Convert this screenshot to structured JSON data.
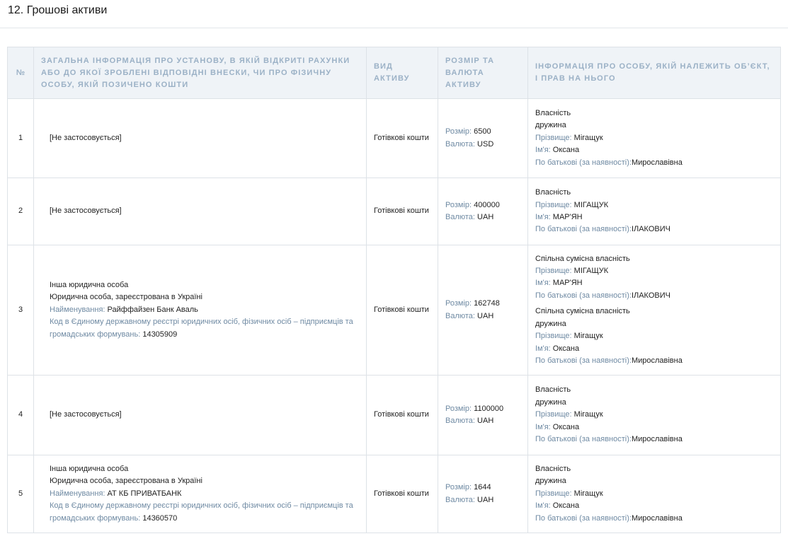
{
  "section_title": "12. Грошові активи",
  "columns": {
    "num": "№",
    "info": "Загальна інформація про установу, в якій відкриті рахунки або до якої зроблені відповідні внески, чи про фізичну особу, якій позичено кошти",
    "type": "Вид активу",
    "size": "Розмір та валюта активу",
    "owner": "Інформація про особу, якій належить об’єкт, і прав на нього"
  },
  "labels": {
    "size": "Розмір:",
    "currency": "Валюта:",
    "surname": "Прізвище:",
    "name": "Ім'я:",
    "patronymic": "По батькові (за наявності):",
    "org_name": "Найменування:",
    "org_code": "Код в Єдиному державному реєстрі юридичних осіб, фізичних осіб – підприємців та громадських формувань:"
  },
  "rows": [
    {
      "num": "1",
      "info_text": "[Не застосовується]",
      "asset_type": "Готівкові кошти",
      "size": "6500",
      "currency": "USD",
      "owners": [
        {
          "right": "Власність",
          "relation": "дружина",
          "surname": "Мігащук",
          "name": "Оксана",
          "patronymic": "Мирославівна"
        }
      ]
    },
    {
      "num": "2",
      "info_text": "[Не застосовується]",
      "asset_type": "Готівкові кошти",
      "size": "400000",
      "currency": "UAH",
      "owners": [
        {
          "right": "Власність",
          "surname": "МІГАЩУК",
          "name": "МАР'ЯН",
          "patronymic": "ІЛАКОВИЧ"
        }
      ]
    },
    {
      "num": "3",
      "org_kind": "Інша юридична особа",
      "org_reg": "Юридична особа, зареєстрована в Україні",
      "org_name": "Райффайзен Банк Аваль",
      "org_code": "14305909",
      "asset_type": "Готівкові кошти",
      "size": "162748",
      "currency": "UAH",
      "owners": [
        {
          "right": "Спільна сумісна власність",
          "surname": "МІГАЩУК",
          "name": "МАР'ЯН",
          "patronymic": "ІЛАКОВИЧ"
        },
        {
          "right": "Спільна сумісна власність",
          "relation": "дружина",
          "surname": "Мігащук",
          "name": "Оксана",
          "patronymic": "Мирославівна"
        }
      ]
    },
    {
      "num": "4",
      "info_text": "[Не застосовується]",
      "asset_type": "Готівкові кошти",
      "size": "1100000",
      "currency": "UAH",
      "owners": [
        {
          "right": "Власність",
          "relation": "дружина",
          "surname": "Мігащук",
          "name": "Оксана",
          "patronymic": "Мирославівна"
        }
      ]
    },
    {
      "num": "5",
      "org_kind": "Інша юридична особа",
      "org_reg": "Юридична особа, зареєстрована в Україні",
      "org_name": "АТ КБ ПРИВАТБАНК",
      "org_code": "14360570",
      "asset_type": "Готівкові кошти",
      "size": "1644",
      "currency": "UAH",
      "owners": [
        {
          "right": "Власність",
          "relation": "дружина",
          "surname": "Мігащук",
          "name": "Оксана",
          "patronymic": "Мирославівна"
        }
      ]
    }
  ]
}
